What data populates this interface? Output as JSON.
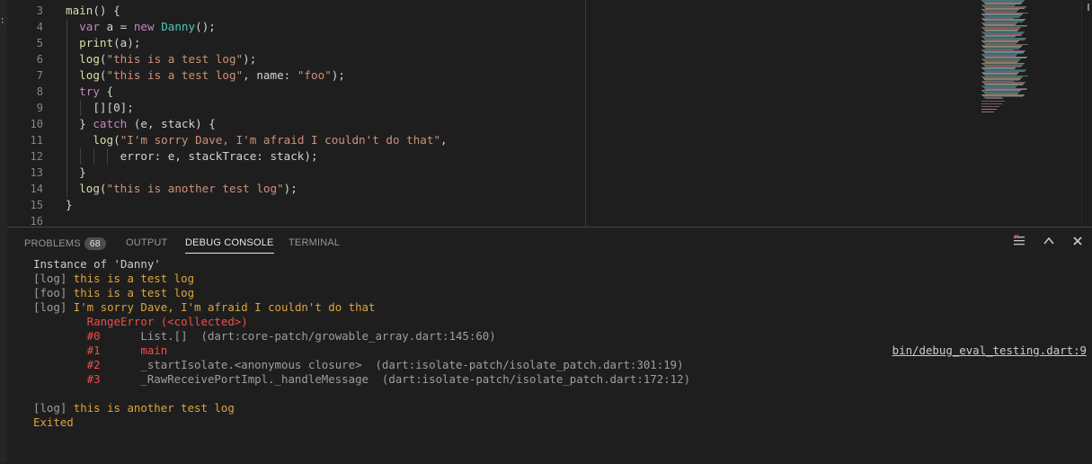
{
  "editor": {
    "line_numbers": [
      "3",
      "4",
      "5",
      "6",
      "7",
      "8",
      "9",
      "10",
      "11",
      "12",
      "13",
      "14",
      "15",
      "16"
    ],
    "lines": [
      [
        {
          "t": "main",
          "c": "fn"
        },
        {
          "t": "() {",
          "c": "plain"
        }
      ],
      [
        {
          "t": "  ",
          "c": "plain"
        },
        {
          "t": "var",
          "c": "kw"
        },
        {
          "t": " a = ",
          "c": "plain"
        },
        {
          "t": "new",
          "c": "kw"
        },
        {
          "t": " ",
          "c": "plain"
        },
        {
          "t": "Danny",
          "c": "cls"
        },
        {
          "t": "();",
          "c": "plain"
        }
      ],
      [
        {
          "t": "  ",
          "c": "plain"
        },
        {
          "t": "print",
          "c": "fn"
        },
        {
          "t": "(a);",
          "c": "plain"
        }
      ],
      [
        {
          "t": "  ",
          "c": "plain"
        },
        {
          "t": "log",
          "c": "fn"
        },
        {
          "t": "(",
          "c": "plain"
        },
        {
          "t": "\"this is a test log\"",
          "c": "str"
        },
        {
          "t": ");",
          "c": "plain"
        }
      ],
      [
        {
          "t": "  ",
          "c": "plain"
        },
        {
          "t": "log",
          "c": "fn"
        },
        {
          "t": "(",
          "c": "plain"
        },
        {
          "t": "\"this is a test log\"",
          "c": "str"
        },
        {
          "t": ", name: ",
          "c": "plain"
        },
        {
          "t": "\"foo\"",
          "c": "str"
        },
        {
          "t": ");",
          "c": "plain"
        }
      ],
      [
        {
          "t": "  ",
          "c": "plain"
        },
        {
          "t": "try",
          "c": "kw"
        },
        {
          "t": " {",
          "c": "plain"
        }
      ],
      [
        {
          "t": "    [][0];",
          "c": "plain"
        }
      ],
      [
        {
          "t": "  } ",
          "c": "plain"
        },
        {
          "t": "catch",
          "c": "kw"
        },
        {
          "t": " (e, stack) {",
          "c": "plain"
        }
      ],
      [
        {
          "t": "    ",
          "c": "plain"
        },
        {
          "t": "log",
          "c": "fn"
        },
        {
          "t": "(",
          "c": "plain"
        },
        {
          "t": "\"I'm sorry Dave, I'm afraid I couldn't do that\"",
          "c": "str"
        },
        {
          "t": ",",
          "c": "plain"
        }
      ],
      [
        {
          "t": "        error: e, stackTrace: stack);",
          "c": "plain"
        }
      ],
      [
        {
          "t": "  }",
          "c": "plain"
        }
      ],
      [
        {
          "t": "  ",
          "c": "plain"
        },
        {
          "t": "log",
          "c": "fn"
        },
        {
          "t": "(",
          "c": "plain"
        },
        {
          "t": "\"this is another test log\"",
          "c": "str"
        },
        {
          "t": ");",
          "c": "plain"
        }
      ],
      [
        {
          "t": "}",
          "c": "plain"
        }
      ],
      [
        {
          "t": "",
          "c": "plain"
        }
      ]
    ]
  },
  "panel": {
    "tabs": {
      "problems": "PROBLEMS",
      "problems_count": "68",
      "output": "OUTPUT",
      "debug_console": "DEBUG CONSOLE",
      "terminal": "TERMINAL"
    },
    "icons": {
      "clear": "clear-console-icon",
      "maximize": "chevron-up-icon",
      "close": "close-icon"
    }
  },
  "console": {
    "lines": [
      [
        {
          "t": "Instance of 'Danny'",
          "c": "white"
        }
      ],
      [
        {
          "t": "[log] ",
          "c": "gray"
        },
        {
          "t": "this is a test log",
          "c": "orange"
        }
      ],
      [
        {
          "t": "[foo] ",
          "c": "gray"
        },
        {
          "t": "this is a test log",
          "c": "orange"
        }
      ],
      [
        {
          "t": "[log] ",
          "c": "gray"
        },
        {
          "t": "I'm sorry Dave, I'm afraid I couldn't do that",
          "c": "orange"
        }
      ],
      [
        {
          "t": "        RangeError (<collected>)",
          "c": "red"
        }
      ],
      [
        {
          "t": "        #0      ",
          "c": "red"
        },
        {
          "t": "List.[]  (dart:core-patch/growable_array.dart:145:60)",
          "c": "dim"
        }
      ],
      [
        {
          "t": "        #1      ",
          "c": "red"
        },
        {
          "t": "main",
          "c": "red"
        }
      ],
      [
        {
          "t": "        #2      ",
          "c": "red"
        },
        {
          "t": "_startIsolate.<anonymous closure>  (dart:isolate-patch/isolate_patch.dart:301:19)",
          "c": "dim"
        }
      ],
      [
        {
          "t": "        #3      ",
          "c": "red"
        },
        {
          "t": "_RawReceivePortImpl._handleMessage  (dart:isolate-patch/isolate_patch.dart:172:12)",
          "c": "dim"
        }
      ],
      [
        {
          "t": "",
          "c": "white"
        }
      ],
      [
        {
          "t": "[log] ",
          "c": "gray"
        },
        {
          "t": "this is another test log",
          "c": "orange"
        }
      ],
      [
        {
          "t": "Exited",
          "c": "orange"
        }
      ]
    ],
    "source_link": "bin/debug_eval_testing.dart:9",
    "source_link_line": 6
  },
  "colors": {
    "background": "#1e1e1e",
    "keyword": "#c586c0",
    "function": "#dcdcaa",
    "string": "#ce9178",
    "class": "#4ec9b0",
    "log_text": "#dca53c",
    "error": "#f14c4c"
  }
}
